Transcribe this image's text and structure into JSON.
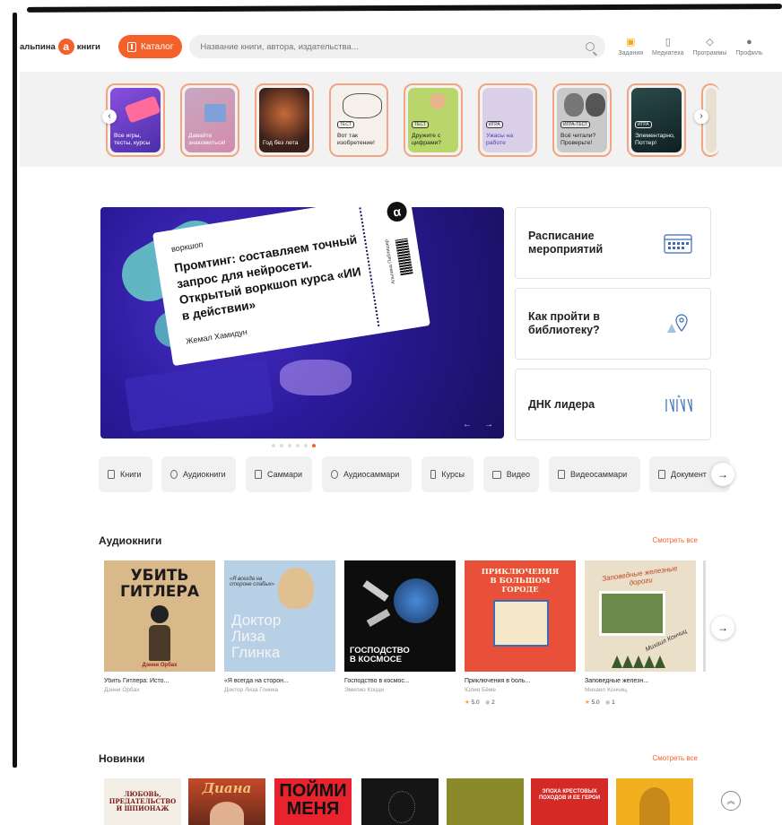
{
  "header": {
    "logo_text_1": "альпина",
    "logo_text_2": "книги",
    "logo_badge": "a",
    "catalog_label": "Каталог",
    "search_placeholder": "Название книги, автора, издательства...",
    "nav": [
      {
        "label": "Задания",
        "icon": "gift-icon"
      },
      {
        "label": "Медиатека",
        "icon": "books-icon"
      },
      {
        "label": "Программы",
        "icon": "graduation-cap-icon"
      },
      {
        "label": "Профиль",
        "icon": "user-icon"
      }
    ]
  },
  "stories": [
    {
      "label": "Все игры, тесты, курсы",
      "tag": ""
    },
    {
      "label": "Давайте знакомиться!",
      "tag": ""
    },
    {
      "label": "Год без лета",
      "tag": ""
    },
    {
      "label": "Вот так изобретение!",
      "tag": "ТЕСТ"
    },
    {
      "label": "Дружите с цифрами?",
      "tag": "ТЕСТ"
    },
    {
      "label": "Ужасы на работе",
      "tag": "ИГРА"
    },
    {
      "label": "Всё читали? Проверьте!",
      "tag": "ИГРА-ТЕСТ"
    },
    {
      "label": "Элементарно, Поттер!",
      "tag": "ИГРА"
    }
  ],
  "banner": {
    "kicker": "воркшоп",
    "title": "Промтинг: составляем точный запрос для нейросети. Открытый воркшоп курса «ИИ в действии»",
    "author": "Жемал Хамидун",
    "vertical_text": "Альпина Паблишер",
    "logo_glyph": "α",
    "prev": "←",
    "next": "→"
  },
  "side_cards": [
    {
      "title": "Расписание мероприятий",
      "icon": "calendar-icon"
    },
    {
      "title": "Как пройти в библиотеку?",
      "icon": "location-pin-icon"
    },
    {
      "title": "ДНК лидера",
      "icon": "dna-leader-logo-icon"
    }
  ],
  "formats": [
    "Книги",
    "Аудиокниги",
    "Саммари",
    "Аудиосаммари",
    "Курсы",
    "Видео",
    "Видеосаммари",
    "Документ"
  ],
  "audiobooks": {
    "title": "Аудиокниги",
    "see_all": "Смотреть все",
    "items": [
      {
        "title": "Убить Гитлера: Исто...",
        "author": "Дэнни Орбах",
        "cover_text": "УБИТЬ ГИТЛЕРА",
        "cover_author": "Дэнни Орбах",
        "rating": "",
        "reviews": ""
      },
      {
        "title": "«Я всегда на сторон...",
        "author": "Доктор Лиза Глинка",
        "cover_text": "Доктор Лиза Глинка",
        "cover_quote": "«Я всегда на стороне слабых»",
        "rating": "",
        "reviews": ""
      },
      {
        "title": "Господство в космос...",
        "author": "Эмилио Коцци",
        "cover_text": "ГОСПОДСТВО В КОСМОСЕ",
        "rating": "",
        "reviews": ""
      },
      {
        "title": "Приключения в боль...",
        "author": "Юлия Бёме",
        "cover_text": "ПРИКЛЮЧЕНИЯ В БОЛЬШОМ ГОРОДЕ",
        "rating": "5.0",
        "reviews": "2"
      },
      {
        "title": "Заповедные железн...",
        "author": "Михаил Кончиц",
        "cover_text": "Заповедные железные дороги",
        "cover_author": "Михаил Кончиц",
        "rating": "5.0",
        "reviews": "1"
      }
    ]
  },
  "new_books": {
    "title": "Новинки",
    "see_all": "Смотреть все",
    "covers": [
      {
        "text": "ЛЮБОВЬ, ПРЕДАТЕЛЬСТВО И ШПИОНАЖ",
        "bg": "#f4efe6"
      },
      {
        "text": "Диана",
        "bg": "#c44a2a"
      },
      {
        "text": "ПОЙМИ МЕНЯ",
        "bg": "#e8232d"
      },
      {
        "text": "",
        "bg": "#1a1a1a"
      },
      {
        "text": "",
        "bg": "#8a8a2a"
      },
      {
        "text": "ЭПОХА КРЕСТОВЫХ ПОХОДОВ И ЕЕ ГЕРОИ",
        "bg": "#d42a26"
      },
      {
        "text": "",
        "bg": "#f2b01e"
      }
    ]
  },
  "colors": {
    "accent": "#f4602a",
    "banner": "#2a1a9a"
  }
}
